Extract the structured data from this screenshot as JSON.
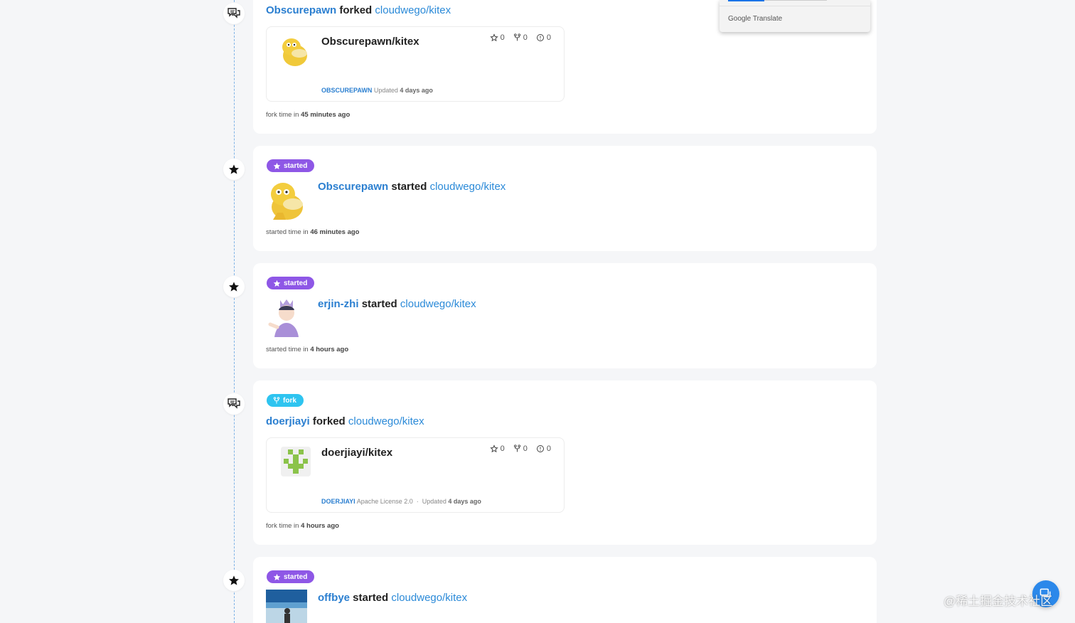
{
  "feed": [
    {
      "type": "fork",
      "user": "Obscurepawn",
      "verb": "forked",
      "repo": "cloudwego/kitex",
      "repo_card": {
        "name": "Obscurepawn/kitex",
        "stars": "0",
        "forks": "0",
        "issues": "0",
        "owner": "OBSCUREPAWN",
        "license": "",
        "updated_label": "Updated",
        "updated_time": "4 days ago"
      },
      "time_label": "fork time in",
      "time_value": "45 minutes ago"
    },
    {
      "type": "started",
      "badge": "started",
      "user": "Obscurepawn",
      "verb": "started",
      "repo": "cloudwego/kitex",
      "time_label": "started time in",
      "time_value": "46 minutes ago"
    },
    {
      "type": "started",
      "badge": "started",
      "user": "erjin-zhi",
      "verb": "started",
      "repo": "cloudwego/kitex",
      "time_label": "started time in",
      "time_value": "4 hours ago"
    },
    {
      "type": "fork",
      "badge": "fork",
      "user": "doerjiayi",
      "verb": "forked",
      "repo": "cloudwego/kitex",
      "repo_card": {
        "name": "doerjiayi/kitex",
        "stars": "0",
        "forks": "0",
        "issues": "0",
        "owner": "DOERJIAYI",
        "license": "Apache License 2.0",
        "separator": "·",
        "updated_label": "Updated",
        "updated_time": "4 days ago"
      },
      "time_label": "fork time in",
      "time_value": "4 hours ago"
    },
    {
      "type": "started",
      "badge": "started",
      "user": "offbye",
      "verb": "started",
      "repo": "cloudwego/kitex"
    }
  ],
  "translate_popup": {
    "label": "Google Translate"
  },
  "watermark": "@稀土掘金技术社区",
  "colors": {
    "link": "#2b7fd0",
    "started_badge": "#8e57e6",
    "fork_badge": "#2ec4f0",
    "timeline": "#7fb3e6"
  },
  "icons": [
    "comments-icon",
    "star-icon",
    "fork-icon",
    "issue-icon"
  ]
}
